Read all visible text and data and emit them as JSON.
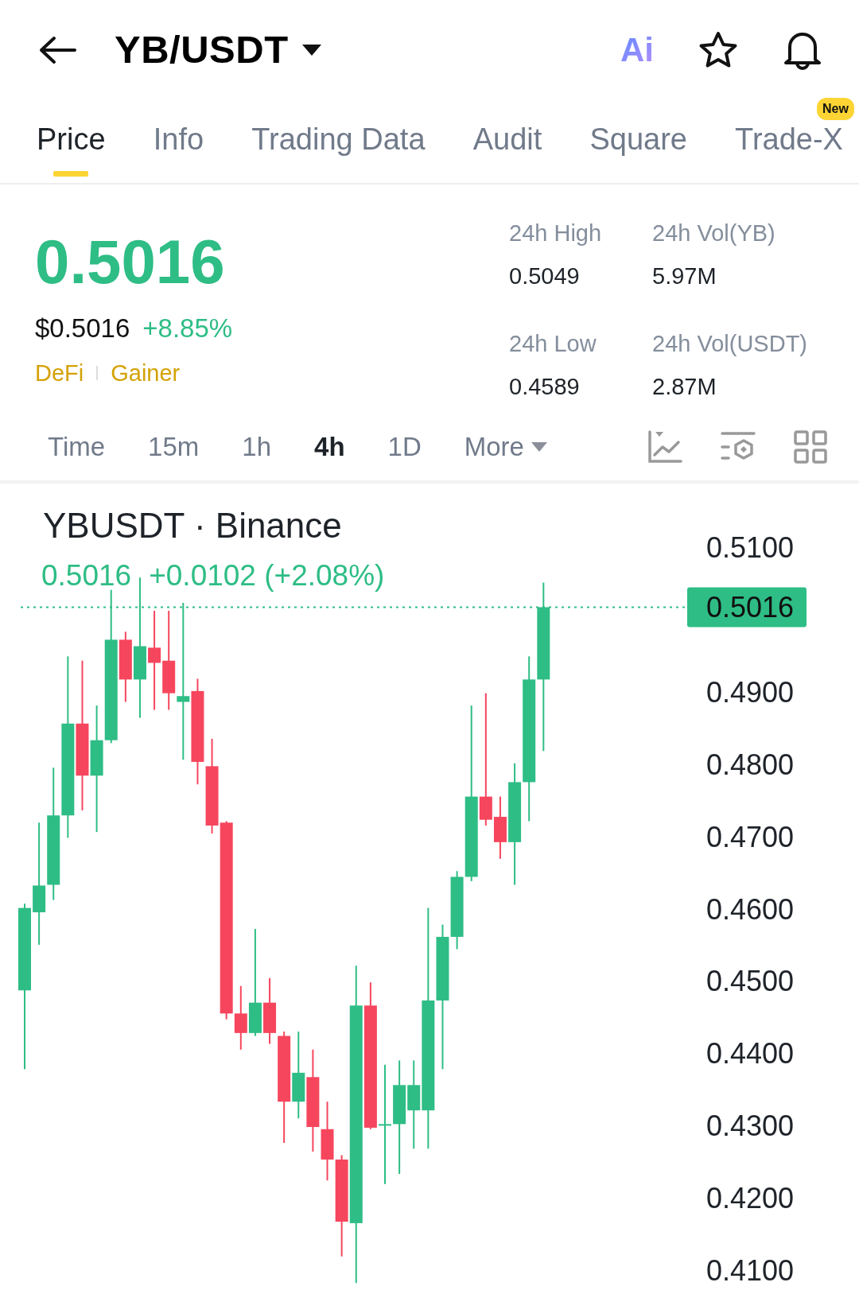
{
  "header": {
    "pair": "YB/USDT",
    "ai_label": "Ai"
  },
  "tabs": [
    {
      "label": "Price",
      "selected": true
    },
    {
      "label": "Info",
      "selected": false
    },
    {
      "label": "Trading Data",
      "selected": false
    },
    {
      "label": "Audit",
      "selected": false
    },
    {
      "label": "Square",
      "selected": false
    },
    {
      "label": "Trade-X",
      "selected": false,
      "badge": "New"
    }
  ],
  "ticker": {
    "price": "0.5016",
    "usd_price": "$0.5016",
    "change": "+8.85%",
    "tags": [
      "DeFi",
      "Gainer"
    ],
    "stats": [
      {
        "label": "24h High",
        "value": "0.5049"
      },
      {
        "label": "24h Vol(YB)",
        "value": "5.97M"
      },
      {
        "label": "24h Low",
        "value": "0.4589"
      },
      {
        "label": "24h Vol(USDT)",
        "value": "2.87M"
      }
    ]
  },
  "intervals": [
    {
      "label": "Time",
      "selected": false
    },
    {
      "label": "15m",
      "selected": false
    },
    {
      "label": "1h",
      "selected": false
    },
    {
      "label": "4h",
      "selected": true
    },
    {
      "label": "1D",
      "selected": false
    },
    {
      "label": "More",
      "selected": false,
      "kind": "dropdown"
    }
  ],
  "chart": {
    "title": "YBUSDT · Binance",
    "last": "0.5016",
    "last_change": "+0.0102 (+2.08%)",
    "price_tag": "0.5016",
    "axis_labels": [
      "0.5100",
      "0.4900",
      "0.4800",
      "0.4700",
      "0.4600",
      "0.4500",
      "0.4400",
      "0.4300",
      "0.4200",
      "0.4100"
    ]
  }
}
